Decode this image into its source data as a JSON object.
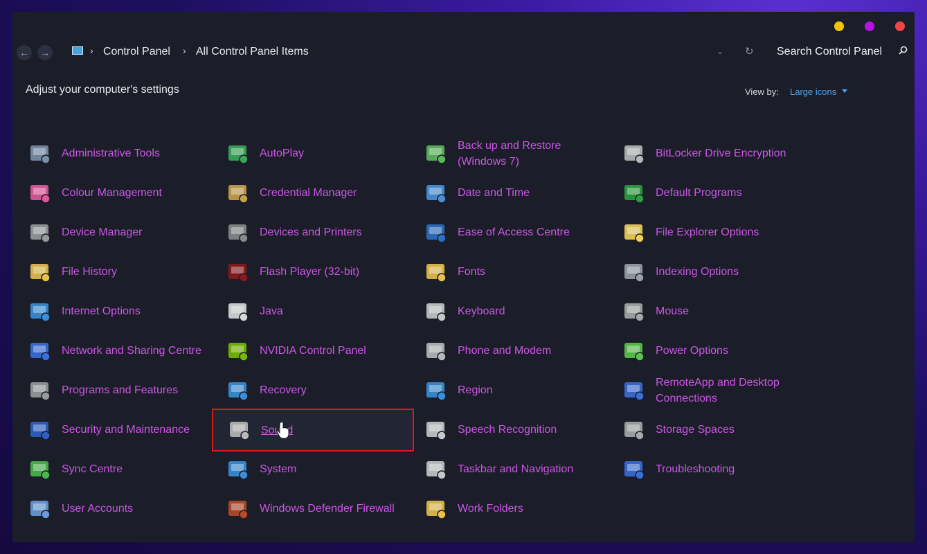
{
  "window": {
    "controls": [
      {
        "name": "minimize",
        "color": "#f5c400"
      },
      {
        "name": "maximize",
        "color": "#b512e6"
      },
      {
        "name": "close",
        "color": "#f04545"
      }
    ]
  },
  "address": {
    "crumbs": [
      "Control Panel",
      "All Control Panel Items"
    ],
    "search_placeholder": "Search Control Panel"
  },
  "header": {
    "title": "Adjust your computer's settings",
    "view_by_label": "View by:",
    "view_by_value": "Large icons"
  },
  "items": [
    {
      "label": "Administrative Tools",
      "icon": "admin-tools-icon",
      "color": "#7a8fa8"
    },
    {
      "label": "AutoPlay",
      "icon": "autoplay-icon",
      "color": "#3aa85a"
    },
    {
      "label": "Back up and Restore (Windows 7)",
      "icon": "backup-icon",
      "color": "#5cb85c"
    },
    {
      "label": "BitLocker Drive Encryption",
      "icon": "bitlocker-icon",
      "color": "#b8b8b8"
    },
    {
      "label": "Colour Management",
      "icon": "colour-management-icon",
      "color": "#e05a9a"
    },
    {
      "label": "Credential Manager",
      "icon": "credential-manager-icon",
      "color": "#c9a14a"
    },
    {
      "label": "Date and Time",
      "icon": "date-time-icon",
      "color": "#4a90d9"
    },
    {
      "label": "Default Programs",
      "icon": "default-programs-icon",
      "color": "#2e9e3e"
    },
    {
      "label": "Device Manager",
      "icon": "device-manager-icon",
      "color": "#9a9a9a"
    },
    {
      "label": "Devices and Printers",
      "icon": "devices-printers-icon",
      "color": "#8a8a8a"
    },
    {
      "label": "Ease of Access Centre",
      "icon": "ease-of-access-icon",
      "color": "#2f6fc4"
    },
    {
      "label": "File Explorer Options",
      "icon": "file-explorer-options-icon",
      "color": "#f2cf5b"
    },
    {
      "label": "File History",
      "icon": "file-history-icon",
      "color": "#e8c04a"
    },
    {
      "label": "Flash Player (32-bit)",
      "icon": "flash-player-icon",
      "color": "#8b1a1a"
    },
    {
      "label": "Fonts",
      "icon": "fonts-icon",
      "color": "#e8c04a"
    },
    {
      "label": "Indexing Options",
      "icon": "indexing-options-icon",
      "color": "#9aa0a8"
    },
    {
      "label": "Internet Options",
      "icon": "internet-options-icon",
      "color": "#3a8fd9"
    },
    {
      "label": "Java",
      "icon": "java-icon",
      "color": "#d9d9d9"
    },
    {
      "label": "Keyboard",
      "icon": "keyboard-icon",
      "color": "#c8c8c8"
    },
    {
      "label": "Mouse",
      "icon": "mouse-icon",
      "color": "#a8a8a8"
    },
    {
      "label": "Network and Sharing Centre",
      "icon": "network-sharing-icon",
      "color": "#3a6fd9"
    },
    {
      "label": "NVIDIA Control Panel",
      "icon": "nvidia-icon",
      "color": "#76b900"
    },
    {
      "label": "Phone and Modem",
      "icon": "phone-modem-icon",
      "color": "#b8b8b8"
    },
    {
      "label": "Power Options",
      "icon": "power-options-icon",
      "color": "#5cc24a"
    },
    {
      "label": "Programs and Features",
      "icon": "programs-features-icon",
      "color": "#9a9a9a"
    },
    {
      "label": "Recovery",
      "icon": "recovery-icon",
      "color": "#3a8fd9"
    },
    {
      "label": "Region",
      "icon": "region-icon",
      "color": "#3a8fd9"
    },
    {
      "label": "RemoteApp and Desktop Connections",
      "icon": "remoteapp-icon",
      "color": "#3a6fd9"
    },
    {
      "label": "Security and Maintenance",
      "icon": "security-flag-icon",
      "color": "#2f5fc4"
    },
    {
      "label": "Sound",
      "icon": "speaker-icon",
      "color": "#b8b8b8"
    },
    {
      "label": "Speech Recognition",
      "icon": "microphone-icon",
      "color": "#c8c8c8"
    },
    {
      "label": "Storage Spaces",
      "icon": "storage-spaces-icon",
      "color": "#a8a8a8"
    },
    {
      "label": "Sync Centre",
      "icon": "sync-centre-icon",
      "color": "#4ab84a"
    },
    {
      "label": "System",
      "icon": "system-icon",
      "color": "#3a8fd9"
    },
    {
      "label": "Taskbar and Navigation",
      "icon": "taskbar-icon",
      "color": "#c8c8c8"
    },
    {
      "label": "Troubleshooting",
      "icon": "troubleshooting-icon",
      "color": "#3a6fd9"
    },
    {
      "label": "User Accounts",
      "icon": "user-accounts-icon",
      "color": "#6a9ad9"
    },
    {
      "label": "Windows Defender Firewall",
      "icon": "firewall-icon",
      "color": "#b84a2a"
    },
    {
      "label": "Work Folders",
      "icon": "work-folders-icon",
      "color": "#e8c04a"
    }
  ],
  "selected_item": "Sound"
}
